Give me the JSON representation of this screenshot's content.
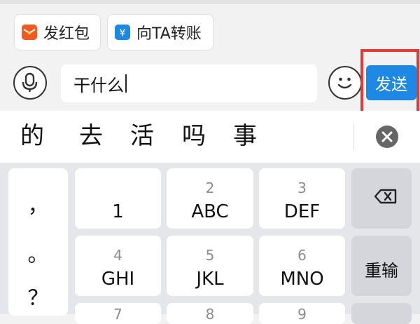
{
  "quick_actions": {
    "red_packet": {
      "label": "发红包",
      "icon": "red-envelope-icon",
      "color": "#f25a21"
    },
    "transfer": {
      "label": "向TA转账",
      "icon": "yuan-transfer-icon",
      "color": "#1e88e5"
    }
  },
  "composer": {
    "input_value": "干什么",
    "send_label": "发送",
    "send_color": "#1e88e5",
    "highlight_color": "#e53935"
  },
  "candidates": [
    "的",
    "去",
    "活",
    "吗",
    "事"
  ],
  "keyboard": {
    "punctuation": [
      "，",
      "。",
      "？"
    ],
    "keys": [
      {
        "num": "",
        "main": "1"
      },
      {
        "num": "2",
        "main": "ABC"
      },
      {
        "num": "3",
        "main": "DEF"
      },
      {
        "num": "4",
        "main": "GHI"
      },
      {
        "num": "5",
        "main": "JKL"
      },
      {
        "num": "6",
        "main": "MNO"
      }
    ],
    "retype_label": "重输",
    "bottom_row_nums": [
      "7",
      "8",
      "9"
    ]
  }
}
